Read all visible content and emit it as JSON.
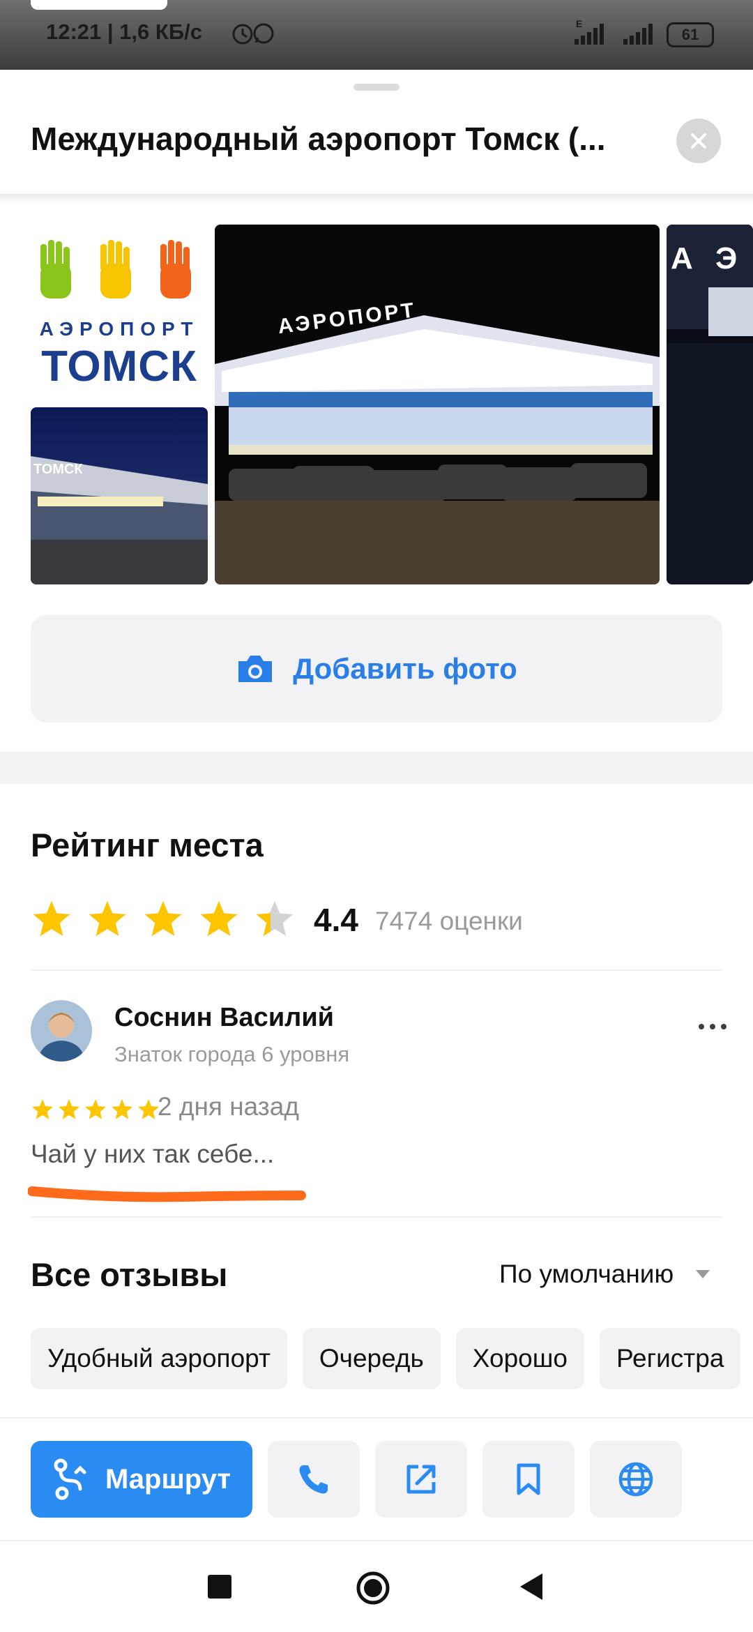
{
  "status_bar": {
    "time": "12:21 | 1,6 КБ/с",
    "battery": "61",
    "network": "E"
  },
  "header": {
    "title": "Международный аэропорт Томск (...",
    "close_icon": "close-icon"
  },
  "photos": {
    "logo": {
      "top_text": "АЭРОПОРТ",
      "main_text": "ТОМСК"
    },
    "small_sign": "ТОМСК",
    "main_sign": "АЭРОПОРТ",
    "side_sign": "А Э"
  },
  "add_photo": {
    "label": "Добавить фото",
    "icon": "camera-icon"
  },
  "rating": {
    "heading": "Рейтинг места",
    "value": "4.4",
    "score": 4.4,
    "count": "7474 оценки",
    "star_color": "#fcc500"
  },
  "review": {
    "author": "Соснин Василий",
    "level": "Знаток города 6 уровня",
    "stars": 5,
    "date": "2 дня назад",
    "text": "Чай у них так себе...",
    "underline_color": "#ff6b1a"
  },
  "reviews": {
    "heading": "Все отзывы",
    "sort_label": "По умолчанию",
    "chips": [
      "Удобный аэропорт",
      "Очередь",
      "Хорошо",
      "Регистра"
    ]
  },
  "actions": {
    "route_label": "Маршрут",
    "icons": [
      "phone-icon",
      "share-icon",
      "bookmark-icon",
      "globe-icon"
    ],
    "accent": "#2a8bf2"
  }
}
